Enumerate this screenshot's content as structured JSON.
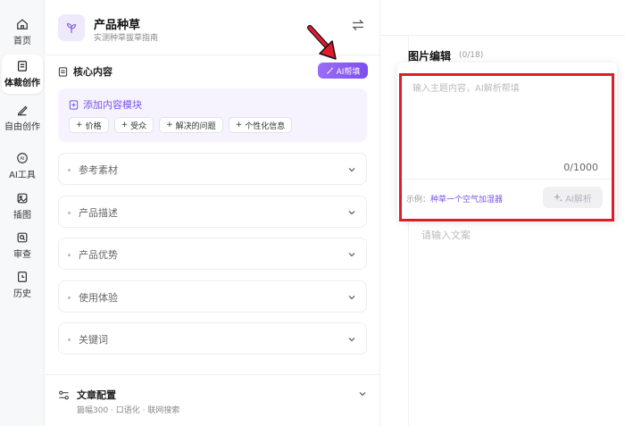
{
  "nav": {
    "items": [
      {
        "label": "首页",
        "icon": "home-icon"
      },
      {
        "label": "体裁创作",
        "icon": "document-icon",
        "active": true
      },
      {
        "label": "自由创作",
        "icon": "pen-icon"
      },
      {
        "label": "AI工具",
        "icon": "ai-icon"
      },
      {
        "label": "插图",
        "icon": "image-icon"
      },
      {
        "label": "审查",
        "icon": "review-icon"
      },
      {
        "label": "历史",
        "icon": "history-icon"
      }
    ]
  },
  "header": {
    "title": "产品种草",
    "subtitle": "实测种草拔草指南"
  },
  "core": {
    "title": "核心内容",
    "ai_help_label": "AI帮填",
    "add_module_label": "添加内容模块",
    "chips": [
      "价格",
      "受众",
      "解决的问题",
      "个性化信息"
    ]
  },
  "sections": [
    "参考素材",
    "产品描述",
    "产品优势",
    "使用体验",
    "关键词"
  ],
  "config": {
    "title": "文章配置",
    "subtitle": "篇幅300 · 口语化 · 联网搜索"
  },
  "image_editor": {
    "title": "图片编辑",
    "count": "(0/18)",
    "body_placeholder": "请输入文案"
  },
  "popup": {
    "input_placeholder": "输入主题内容，AI解析帮填",
    "counter": "0/1000",
    "example_prefix": "示例：",
    "example_text": "种草一个空气加湿器",
    "parse_label": "AI解析"
  },
  "colors": {
    "accent": "#7c4ff0",
    "highlight": "#e01b2b"
  }
}
